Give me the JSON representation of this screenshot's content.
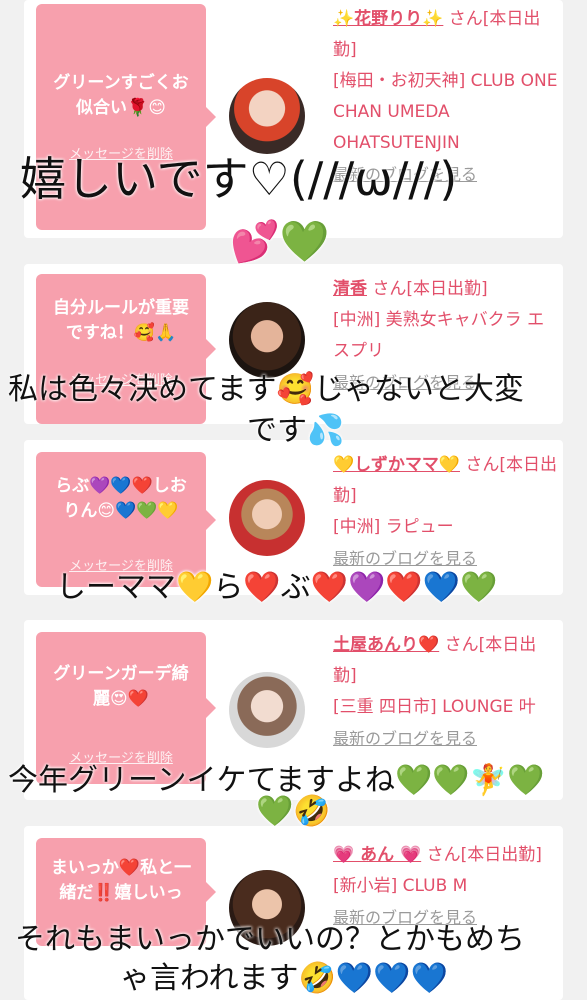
{
  "cards": [
    {
      "message": "グリーンすごくお似合い🌹😊",
      "delete_label": "メッセージを削除",
      "name": "✨花野りり✨",
      "san": "さん[本日出勤]",
      "location": "[梅田・お初天神] CLUB ONE CHAN UMEDA OHATSUTENJIN",
      "blog": "最新のブログを見る"
    },
    {
      "message": "自分ルールが重要ですね！🥰🙏",
      "delete_label": "メッセージを削除",
      "name": "清香",
      "san": "さん[本日出勤]",
      "location": "[中洲] 美熟女キャバクラ エスプリ",
      "blog": "最新のブログを見る"
    },
    {
      "message": "らぶ💜💙❤️しおりん😊💙💚💛",
      "delete_label": "メッセージを削除",
      "name": "💛しずかママ💛",
      "san": "さん[本日出勤]",
      "location": "[中洲] ラピュー",
      "blog": "最新のブログを見る"
    },
    {
      "message": "グリーンガーデ綺麗😍❤️",
      "delete_label": "メッセージを削除",
      "name": "土屋あんり❤️",
      "san": "さん[本日出勤]",
      "location": "[三重 四日市] LOUNGE 叶",
      "blog": "最新のブログを見る"
    },
    {
      "message": "まいっか❤️私と一緒だ‼️嬉しいっ",
      "delete_label": "メッセージを削除",
      "name": "💗 あん 💗",
      "san": "さん[本日出勤]",
      "location": "[新小岩] CLUB M",
      "blog": "最新のブログを見る"
    }
  ],
  "overlays": {
    "o1": "嬉しいです♡(///ω///)",
    "o1b": "💕💚",
    "o2a": "私は色々決めてます🥰じゃないと大変",
    "o2b": "です💦",
    "o3": "しーママ💛ら❤️ぶ❤️💜❤️💙💚",
    "o4a": "今年グリーンイケてますよね💚💚🧚💚",
    "o4b": "💚🤣",
    "o5a": "それもまいっかでいいの？とかもめち",
    "o5b": "ゃ言われます🤣💙💙💙"
  },
  "colors": {
    "accent": "#e24f6a",
    "bubble": "#f7a0ad",
    "background": "#f1f1f1"
  }
}
